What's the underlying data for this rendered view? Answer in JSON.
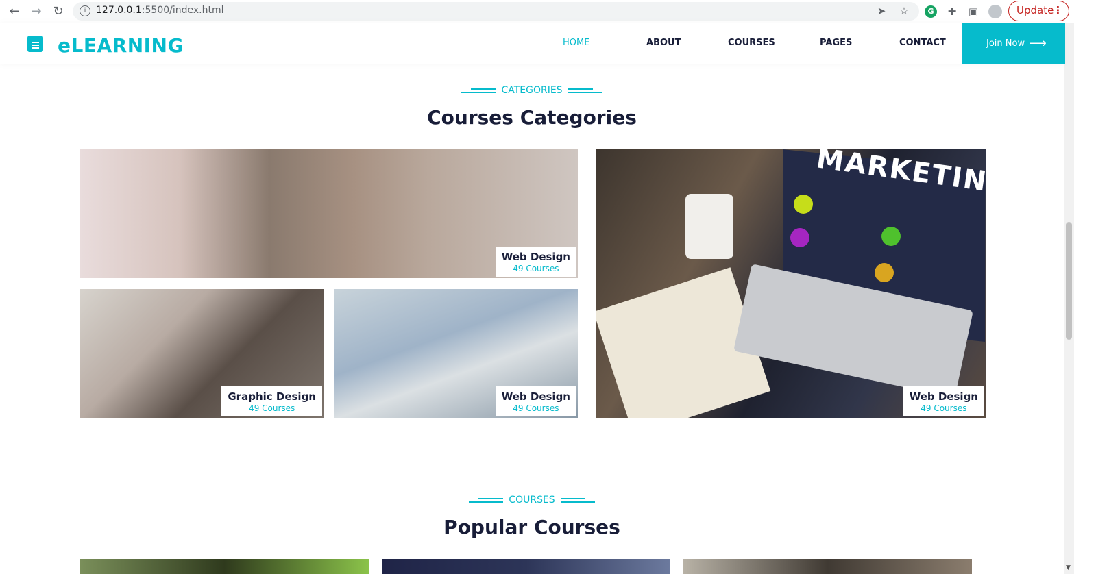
{
  "browser": {
    "url_host": "127.0.0.1",
    "url_path": ":5500/index.html",
    "update_label": "Update"
  },
  "nav": {
    "brand": "eLEARNING",
    "items": [
      "HOME",
      "ABOUT",
      "COURSES",
      "PAGES",
      "CONTACT"
    ],
    "active": "HOME",
    "cta": "Join Now",
    "accent": "#06bbcc",
    "dark": "#181d38"
  },
  "categories_section": {
    "subtitle": "CATEGORIES",
    "title": "Courses Categories",
    "tiles": [
      {
        "title": "Web Design",
        "count": "49 Courses"
      },
      {
        "title": "Graphic Design",
        "count": "49 Courses"
      },
      {
        "title": "Web Design",
        "count": "49 Courses"
      },
      {
        "title": "Web Design",
        "count": "49 Courses"
      }
    ],
    "marketing_text": "MARKETING"
  },
  "courses_section": {
    "subtitle": "COURSES",
    "title": "Popular Courses"
  }
}
